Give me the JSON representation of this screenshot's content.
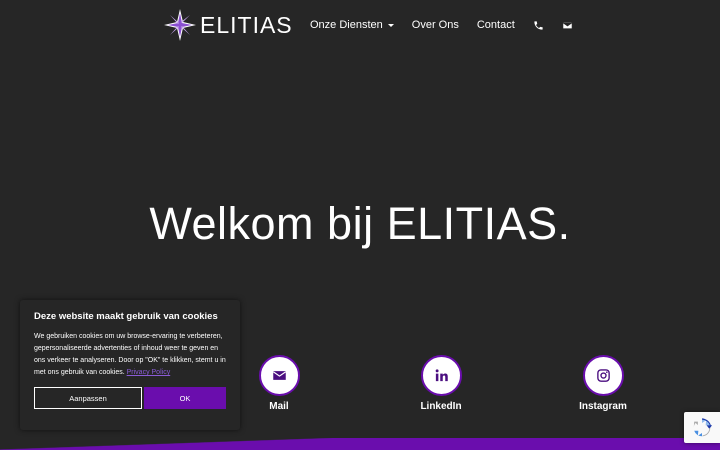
{
  "header": {
    "logo_text": "ELITIAS",
    "nav": [
      {
        "label": "Onze Diensten",
        "has_dropdown": true
      },
      {
        "label": "Over Ons"
      },
      {
        "label": "Contact"
      }
    ],
    "icons": [
      "phone-icon",
      "envelope-icon"
    ]
  },
  "hero": {
    "title": "Welkom bij ELITIAS."
  },
  "social": [
    {
      "label": "Mail",
      "icon": "envelope-icon"
    },
    {
      "label": "LinkedIn",
      "icon": "linkedin-icon"
    },
    {
      "label": "Instagram",
      "icon": "instagram-icon"
    }
  ],
  "cookie": {
    "title": "Deze website maakt gebruik van cookies",
    "text": "We gebruiken cookies om uw browse-ervaring te verbeteren, gepersonaliseerde advertenties of inhoud weer te geven en ons verkeer te analyseren. Door op \"OK\" te klikken, stemt u in met ons gebruik van cookies.",
    "link_label": "Privacy Policy",
    "customize_label": "Aanpassen",
    "ok_label": "OK"
  },
  "colors": {
    "background": "#262626",
    "accent": "#6a0dad",
    "text": "#ffffff"
  }
}
